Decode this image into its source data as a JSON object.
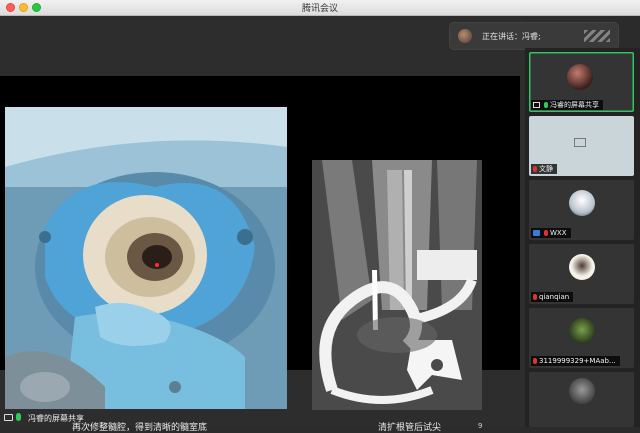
{
  "window": {
    "title": "腾讯会议"
  },
  "speaking": {
    "label": "正在讲话：冯睿;"
  },
  "slide": {
    "caption_left": "再次修整髓腔，得到清晰的髓室底",
    "caption_right": "清扩根管后试尖",
    "page_number": "9"
  },
  "share_bar": {
    "label": "冯睿的屏幕共享"
  },
  "participants": [
    {
      "name": "冯睿的屏幕共享",
      "mic": "on",
      "icon": "monitor",
      "active": true
    },
    {
      "name": "文静",
      "mic": "off",
      "icon": "none",
      "active": false
    },
    {
      "name": "WXX",
      "mic": "off",
      "icon": "user",
      "active": false
    },
    {
      "name": "qianqian",
      "mic": "off",
      "icon": "none",
      "active": false
    },
    {
      "name": "3119999329+MAab...",
      "mic": "off",
      "icon": "none",
      "active": false
    },
    {
      "name": "",
      "mic": "off",
      "icon": "none",
      "active": false
    }
  ],
  "colors": {
    "accent_green": "#36c164",
    "mic_muted": "#d33333",
    "background": "#2d2d2d"
  }
}
